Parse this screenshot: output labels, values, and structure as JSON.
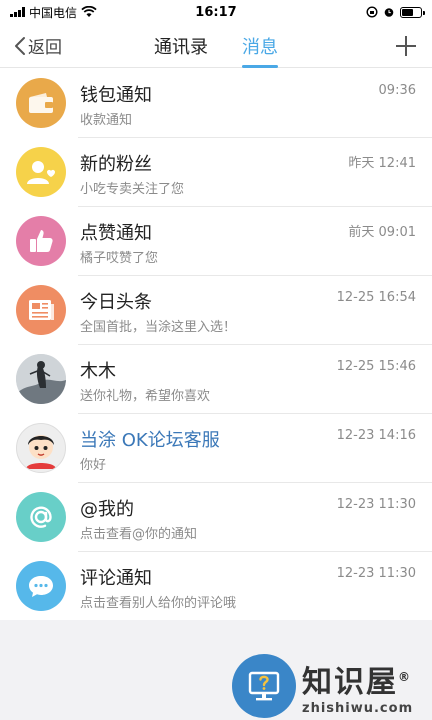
{
  "status_bar": {
    "carrier": "中国电信",
    "time": "16:17"
  },
  "nav": {
    "back_label": "返回",
    "tabs": [
      {
        "label": "通讯录",
        "active": false
      },
      {
        "label": "消息",
        "active": true
      }
    ],
    "accent_color": "#4aa8e6"
  },
  "messages": [
    {
      "title": "钱包通知",
      "subtitle": "收款通知",
      "time": "09:36",
      "icon": "wallet-icon",
      "color": "#e9a94a"
    },
    {
      "title": "新的粉丝",
      "subtitle": "小吃专卖关注了您",
      "time": "昨天 12:41",
      "icon": "new-fan-icon",
      "color": "#f6d24a"
    },
    {
      "title": "点赞通知",
      "subtitle": "橘子哎赞了您",
      "time": "前天 09:01",
      "icon": "thumbs-up-icon",
      "color": "#e47ea8"
    },
    {
      "title": "今日头条",
      "subtitle": "全国首批，当涂这里入选！",
      "time": "12-25 16:54",
      "icon": "newspaper-icon",
      "color": "#ef8d63"
    },
    {
      "title": "木木",
      "subtitle": "送你礼物，希望你喜欢",
      "time": "12-25 15:46",
      "icon": "user-photo-avatar",
      "color": "#9aa4ad"
    },
    {
      "title": "当涂 OK论坛客服",
      "subtitle": "你好",
      "time": "12-23 14:16",
      "icon": "cartoon-boy-avatar",
      "color": "#f1f1f1",
      "highlight": true
    },
    {
      "title": "@我的",
      "subtitle": "点击查看@你的通知",
      "time": "12-23 11:30",
      "icon": "at-sign-icon",
      "color": "#68cfc8"
    },
    {
      "title": "评论通知",
      "subtitle": "点击查看别人给你的评论哦",
      "time": "12-23 11:30",
      "icon": "comment-icon",
      "color": "#56b8ea"
    }
  ],
  "watermark": {
    "brand": "知识屋",
    "registered": "®",
    "domain": "zhishiwu.com"
  }
}
